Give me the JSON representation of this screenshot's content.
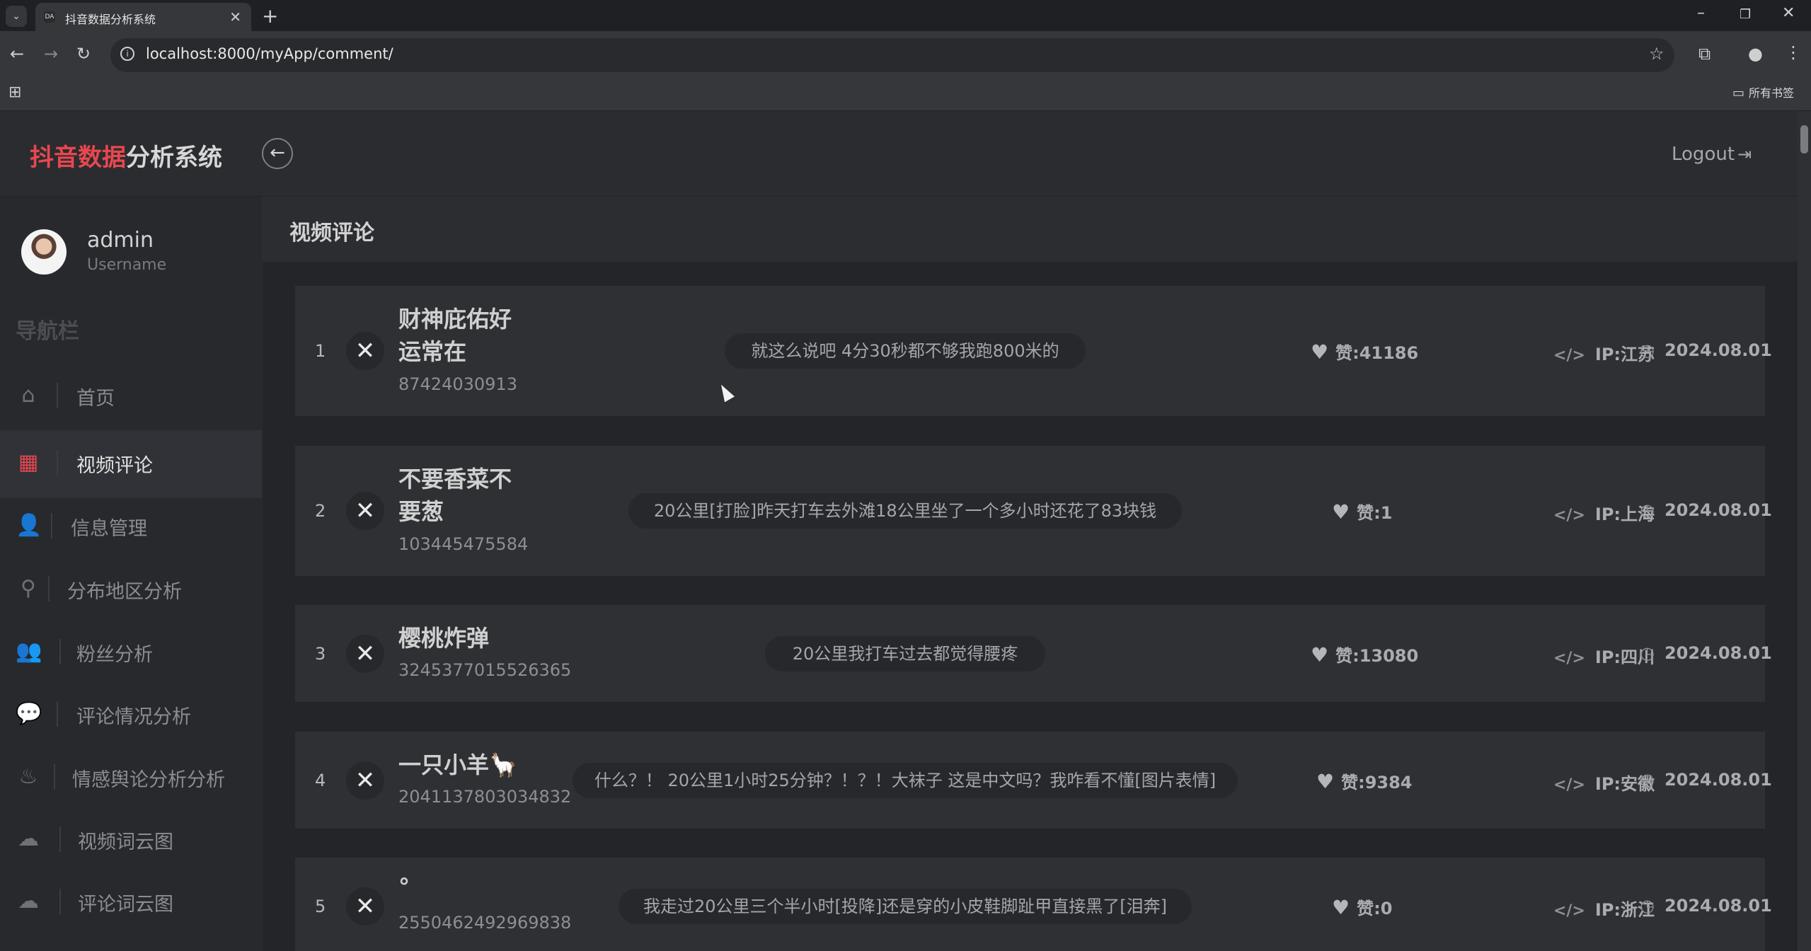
{
  "browser": {
    "tab_title": "抖音数据分析系统",
    "tab_favicon": "DA",
    "url": "localhost:8000/myApp/comment/",
    "bookmarks_label": "所有书签"
  },
  "app": {
    "brand_red": "抖音数据",
    "brand_rest": "分析系统",
    "logout_label": "Logout",
    "accent_color": "#e8474f"
  },
  "user": {
    "name": "admin",
    "role": "Username"
  },
  "sidebar": {
    "heading": "导航栏",
    "items": [
      {
        "label": "首页",
        "icon": "home-icon"
      },
      {
        "label": "视频评论",
        "icon": "grid-icon",
        "active": true
      },
      {
        "label": "信息管理",
        "icon": "user-icon"
      },
      {
        "label": "分布地区分析",
        "icon": "map-pin-icon"
      },
      {
        "label": "粉丝分析",
        "icon": "users-icon"
      },
      {
        "label": "评论情况分析",
        "icon": "comment-icon"
      },
      {
        "label": "情感舆论分析分析",
        "icon": "fire-icon"
      },
      {
        "label": "视频词云图",
        "icon": "cloud-upload-icon"
      },
      {
        "label": "评论词云图",
        "icon": "cloud-upload-icon"
      }
    ]
  },
  "page": {
    "title": "视频评论"
  },
  "comments": [
    {
      "index": "1",
      "name_line1": "财神庇佑好",
      "name_line2": "运常在",
      "uid": "87424030913",
      "text": "就这么说吧 4分30秒都不够我跑800米的",
      "likes": "赞:41186",
      "ip": "IP:江苏",
      "date": "2024.08.01"
    },
    {
      "index": "2",
      "name_line1": "不要香菜不",
      "name_line2": "要葱",
      "uid": "103445475584",
      "text": "20公里[打脸]昨天打车去外滩18公里坐了一个多小时还花了83块钱",
      "likes": "赞:1",
      "ip": "IP:上海",
      "date": "2024.08.01"
    },
    {
      "index": "3",
      "name_line1": "樱桃炸弹",
      "name_line2": "",
      "uid": "3245377015526365",
      "text": "20公里我打车过去都觉得腰疼",
      "likes": "赞:13080",
      "ip": "IP:四川",
      "date": "2024.08.01"
    },
    {
      "index": "4",
      "name_line1": "一只小羊🦙",
      "name_line2": "",
      "uid": "2041137803034832",
      "text": "什么？！ 20公里1小时25分钟？！？！大袜子 这是中文吗？我咋看不懂[图片表情]",
      "likes": "赞:9384",
      "ip": "IP:安徽",
      "date": "2024.08.01"
    },
    {
      "index": "5",
      "name_line1": "°",
      "name_line2": "",
      "uid": "2550462492969838",
      "text": "我走过20公里三个半小时[投降]还是穿的小皮鞋脚趾甲直接黑了[泪奔]",
      "likes": "赞:0",
      "ip": "IP:浙江",
      "date": "2024.08.01"
    }
  ]
}
